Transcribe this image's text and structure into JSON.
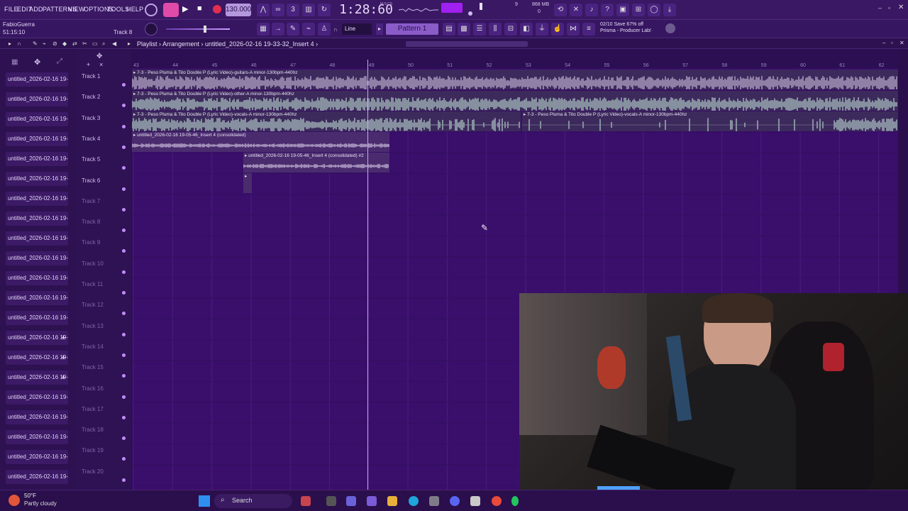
{
  "menu": [
    "FILE",
    "EDIT",
    "ADD",
    "PATTERNS",
    "VIEW",
    "OPTIONS",
    "TOOLS",
    "HELP"
  ],
  "transport": {
    "tempo": "130.000",
    "time": "1:28:60",
    "time_unit": "M:S:CS",
    "mem": "868 MB",
    "cpu": "0",
    "voices": "9"
  },
  "user": {
    "name": "FabioGuerra",
    "time": "51:15:10",
    "track_hint": "Track 8"
  },
  "news": {
    "line1": "02/10  Save 67% off",
    "line2": "Prisma - Producer Lab!"
  },
  "toolbar": {
    "snap": "Line",
    "pattern": "Pattern 1"
  },
  "playlist": {
    "breadcrumb": "Playlist › Arrangement › untitled_2026-02-16 19-33-32_Insert 4 ›"
  },
  "browser_items": [
    "untitled_2026-02-16 19-",
    "untitled_2026-02-16 19-",
    "untitled_2026-02-16 19-",
    "untitled_2026-02-16 19-",
    "untitled_2026-02-16 19-",
    "untitled_2026-02-16 19-",
    "untitled_2026-02-16 19-",
    "untitled_2026-02-16 19-",
    "untitled_2026-02-16 19-",
    "untitled_2026-02-16 19-",
    "untitled_2026-02-16 19-",
    "untitled_2026-02-16 19-",
    "untitled_2026-02-16 19-",
    "untitled_2026-02-16 19-",
    "untitled_2026-02-16 19-",
    "untitled_2026-02-16 19-",
    "untitled_2026-02-16 19-",
    "untitled_2026-02-16 19-",
    "untitled_2026-02-16 19-",
    "untitled_2026-02-16 19-",
    "untitled_2026-02-16 19-",
    "untitled_2026-02-16 19-"
  ],
  "tracks": [
    "Track 1",
    "Track 2",
    "Track 3",
    "Track 4",
    "Track 5",
    "Track 6",
    "Track 7",
    "Track 8",
    "Track 9",
    "Track 10",
    "Track 11",
    "Track 12",
    "Track 13",
    "Track 14",
    "Track 15",
    "Track 16",
    "Track 17",
    "Track 18",
    "Track 19",
    "Track 20"
  ],
  "ruler_numbers": [
    "43",
    "44",
    "45",
    "46",
    "47",
    "48",
    "49",
    "50",
    "51",
    "52",
    "53",
    "54",
    "55",
    "56",
    "57",
    "58",
    "59",
    "60",
    "61",
    "62"
  ],
  "clips": {
    "c1": "▸ 7-3 - Peso Pluma & Tito Double P (Lyric Video)-guitars-A minor-130bpm-440hz",
    "c2": "▸ 7-3 - Peso Pluma & Tito Double P (Lyric Video)-other-A minor-130bpm-440hz",
    "c3": "▸ 7-3 - Peso Pluma & Tito Double P (Lyric Video)-vocals-A minor-130bpm-440hz",
    "c3b": "▸ 7-3 - Peso Pluma & Tito Double P (Lyric Video)-vocals-A minor-130bpm-440hz",
    "c4": "▸ untitled_2026-02-16 19-05-46_Insert 4 (consolidated)",
    "c5": "▸ untitled_2026-02-16 19-05-46_Insert 4 (consolidated) #2",
    "c6": "▸"
  },
  "taskbar": {
    "temp": "50°F",
    "weather": "Partly cloudy",
    "search": "Search"
  }
}
